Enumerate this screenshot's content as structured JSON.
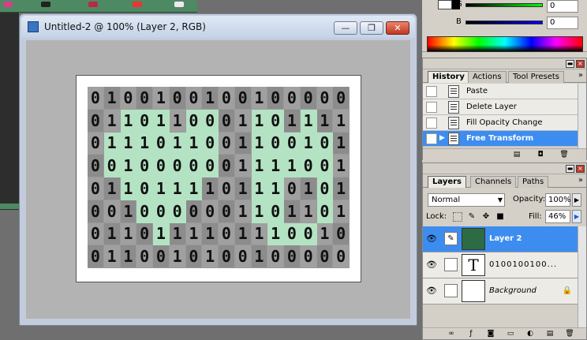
{
  "document_window": {
    "title": "Untitled-2 @ 100% (Layer 2, RGB)",
    "minimize_label": "—",
    "restore_label": "❐",
    "close_label": "✕"
  },
  "binary_grid": {
    "rows": [
      [
        "0",
        "1",
        "0",
        "0",
        "1",
        "0",
        "0",
        "1",
        "0",
        "0",
        "1",
        "0",
        "0",
        "0",
        "0",
        "0"
      ],
      [
        "0",
        "1",
        "1",
        "0",
        "1",
        "1",
        "0",
        "0",
        "0",
        "1",
        "1",
        "0",
        "1",
        "1",
        "1",
        "1"
      ],
      [
        "0",
        "1",
        "1",
        "1",
        "0",
        "1",
        "1",
        "0",
        "0",
        "1",
        "1",
        "0",
        "0",
        "1",
        "0",
        "1"
      ],
      [
        "0",
        "0",
        "1",
        "0",
        "0",
        "0",
        "0",
        "0",
        "0",
        "1",
        "1",
        "1",
        "1",
        "0",
        "0",
        "1"
      ],
      [
        "0",
        "1",
        "1",
        "0",
        "1",
        "1",
        "1",
        "1",
        "0",
        "1",
        "1",
        "1",
        "0",
        "1",
        "0",
        "1"
      ],
      [
        "0",
        "0",
        "1",
        "0",
        "0",
        "0",
        "0",
        "0",
        "0",
        "1",
        "1",
        "0",
        "1",
        "1",
        "0",
        "1"
      ],
      [
        "0",
        "1",
        "1",
        "0",
        "1",
        "1",
        "1",
        "1",
        "0",
        "1",
        "1",
        "1",
        "0",
        "0",
        "1",
        "0"
      ],
      [
        "0",
        "1",
        "1",
        "0",
        "0",
        "1",
        "0",
        "1",
        "0",
        "0",
        "1",
        "0",
        "0",
        "0",
        "0",
        "0"
      ]
    ],
    "highlight": [
      [],
      [
        2,
        3,
        4,
        6,
        7,
        10,
        11,
        13
      ],
      [
        1,
        2,
        3,
        4,
        5,
        6,
        7,
        10,
        11,
        12,
        13,
        14
      ],
      [
        1,
        2,
        3,
        4,
        5,
        6,
        7,
        10,
        11,
        12,
        13,
        14
      ],
      [
        2,
        3,
        4,
        5,
        6,
        10,
        11,
        14
      ],
      [
        3,
        4,
        5,
        10,
        11,
        14
      ],
      [
        4,
        11,
        12,
        13
      ],
      []
    ],
    "highlight_color": "#b4e3c4"
  },
  "color_panel": {
    "g_label": "G",
    "g_value": "0",
    "b_label": "B",
    "b_value": "0"
  },
  "history_panel": {
    "tabs": [
      "History",
      "Actions",
      "Tool Presets"
    ],
    "items": [
      "Paste",
      "Delete Layer",
      "Fill Opacity Change",
      "Free Transform"
    ],
    "selected": "Free Transform"
  },
  "layers_panel": {
    "tabs": [
      "Layers",
      "Channels",
      "Paths"
    ],
    "blend_mode": "Normal",
    "opacity_label": "Opacity:",
    "opacity_value": "100%",
    "lock_label": "Lock:",
    "fill_label": "Fill:",
    "fill_value": "46%",
    "layers": [
      {
        "name": "Layer 2",
        "type": "image"
      },
      {
        "name": "0100100100...",
        "type": "text"
      },
      {
        "name": "Background",
        "type": "background"
      }
    ],
    "accent": "#3d8df0"
  },
  "icons": {
    "eye": "👁",
    "lock": "🔒",
    "text_layer": "T"
  }
}
